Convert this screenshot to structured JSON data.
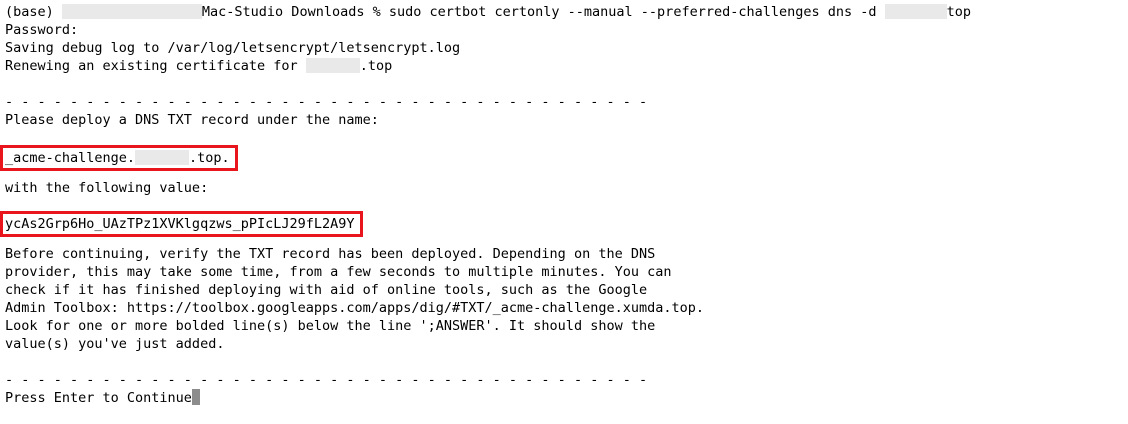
{
  "terminal": {
    "prompt_prefix": "(base) ",
    "prompt_host": "Mac-Studio Downloads % ",
    "command": "sudo certbot certonly --manual --preferred-challenges dns -d ",
    "command_suffix": "top",
    "password_line": "Password:",
    "debug_log_line": "Saving debug log to /var/log/letsencrypt/letsencrypt.log",
    "renewing_prefix": "Renewing an existing certificate for ",
    "renewing_suffix": ".top",
    "separator": "- - - - - - - - - - - - - - - - - - - - - - - - - - - - - - - - - - - - - - - -",
    "deploy_line": "Please deploy a DNS TXT record under the name:",
    "record_name_prefix": "_acme-challenge.",
    "record_name_suffix": ".top.",
    "following_value_line": "with the following value:",
    "txt_value": "ycAs2Grp6Ho_UAzTPz1XVKlgqzws_pPIcLJ29fL2A9Y",
    "info_lines": [
      "Before continuing, verify the TXT record has been deployed. Depending on the DNS",
      "provider, this may take some time, from a few seconds to multiple minutes. You can",
      "check if it has finished deploying with aid of online tools, such as the Google",
      "Admin Toolbox: https://toolbox.googleapps.com/apps/dig/#TXT/_acme-challenge.xumda.top.",
      "Look for one or more bolded line(s) below the line ';ANSWER'. It should show the",
      "value(s) you've just added."
    ],
    "continue_prompt": "Press Enter to Continue"
  }
}
